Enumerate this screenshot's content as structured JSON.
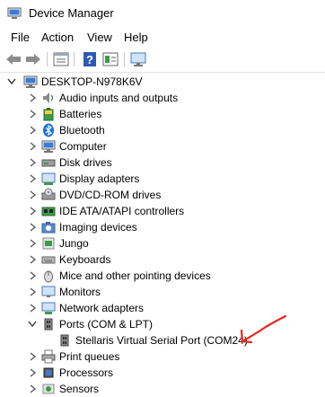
{
  "window": {
    "title": "Device Manager"
  },
  "menu": [
    {
      "label": "File"
    },
    {
      "label": "Action"
    },
    {
      "label": "View"
    },
    {
      "label": "Help"
    }
  ],
  "toolbar": {
    "buttons": [
      "back-arrow-icon",
      "forward-arrow-icon",
      "properties-icon",
      "help-icon",
      "update-driver-icon",
      "monitor-scan-icon"
    ]
  },
  "tree": {
    "root": {
      "label": "DESKTOP-N978K6V"
    },
    "categories": [
      {
        "label": "Audio inputs and outputs",
        "icon": "speaker-icon"
      },
      {
        "label": "Batteries",
        "icon": "battery-icon"
      },
      {
        "label": "Bluetooth",
        "icon": "bluetooth-icon"
      },
      {
        "label": "Computer",
        "icon": "computer-icon"
      },
      {
        "label": "Disk drives",
        "icon": "disk-drive-icon"
      },
      {
        "label": "Display adapters",
        "icon": "display-adapter-icon"
      },
      {
        "label": "DVD/CD-ROM drives",
        "icon": "dvd-drive-icon"
      },
      {
        "label": "IDE ATA/ATAPI controllers",
        "icon": "ide-controller-icon"
      },
      {
        "label": "Imaging devices",
        "icon": "camera-icon"
      },
      {
        "label": "Jungo",
        "icon": "device-icon"
      },
      {
        "label": "Keyboards",
        "icon": "keyboard-icon"
      },
      {
        "label": "Mice and other pointing devices",
        "icon": "mouse-icon"
      },
      {
        "label": "Monitors",
        "icon": "monitor-icon"
      },
      {
        "label": "Network adapters",
        "icon": "network-icon"
      },
      {
        "label": "Ports (COM & LPT)",
        "icon": "port-icon",
        "expanded": true
      },
      {
        "label": "Stellaris Virtual Serial Port (COM24)",
        "icon": "port-icon",
        "child": true
      },
      {
        "label": "Print queues",
        "icon": "printer-icon"
      },
      {
        "label": "Processors",
        "icon": "processor-icon"
      },
      {
        "label": "Sensors",
        "icon": "sensor-icon"
      }
    ]
  },
  "colors": {
    "annotation": "#e8261c",
    "icon_blue": "#3a7bd5",
    "folder_green": "#3c9a4a"
  }
}
